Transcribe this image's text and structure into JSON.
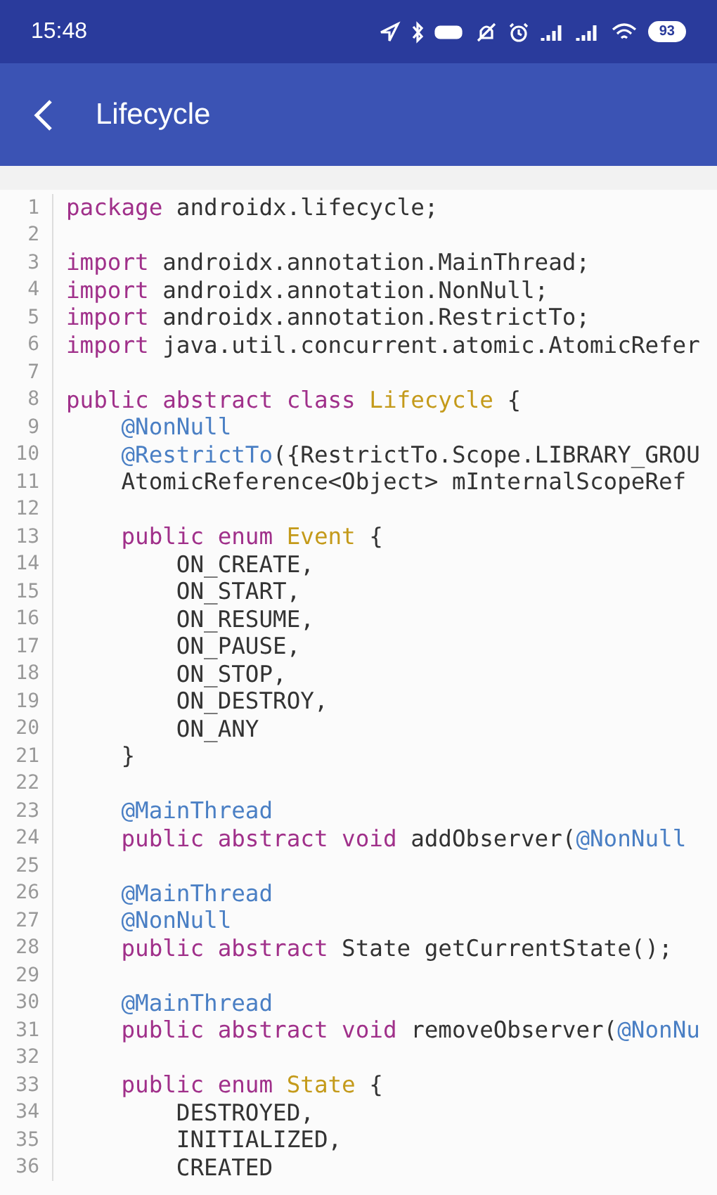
{
  "status_bar": {
    "time": "15:48",
    "battery": "93"
  },
  "app_bar": {
    "title": "Lifecycle"
  },
  "code": {
    "lines": [
      {
        "number": "1",
        "tokens": [
          {
            "kind": "keyword",
            "text": "package"
          },
          {
            "kind": "plain",
            "text": " androidx.lifecycle;"
          }
        ]
      },
      {
        "number": "2"
      },
      {
        "number": "3",
        "tokens": [
          {
            "kind": "keyword",
            "text": "import"
          },
          {
            "kind": "plain",
            "text": " androidx.annotation.MainThread;"
          }
        ]
      },
      {
        "number": "4",
        "tokens": [
          {
            "kind": "keyword",
            "text": "import"
          },
          {
            "kind": "plain",
            "text": " androidx.annotation.NonNull;"
          }
        ]
      },
      {
        "number": "5",
        "tokens": [
          {
            "kind": "keyword",
            "text": "import"
          },
          {
            "kind": "plain",
            "text": " androidx.annotation.RestrictTo;"
          }
        ]
      },
      {
        "number": "6",
        "tokens": [
          {
            "kind": "keyword",
            "text": "import"
          },
          {
            "kind": "plain",
            "text": " java.util.concurrent.atomic.AtomicRefer"
          }
        ]
      },
      {
        "number": "7"
      },
      {
        "number": "8",
        "tokens": [
          {
            "kind": "keyword",
            "text": "public abstract class "
          },
          {
            "kind": "type",
            "text": "Lifecycle"
          },
          {
            "kind": "plain",
            "text": " {"
          }
        ]
      },
      {
        "number": "9",
        "tokens": [
          {
            "kind": "annotation",
            "text": "    @NonNull"
          }
        ]
      },
      {
        "number": "10",
        "tokens": [
          {
            "kind": "annotation",
            "text": "    @RestrictTo"
          },
          {
            "kind": "plain",
            "text": "({RestrictTo.Scope.LIBRARY_GROU"
          }
        ]
      },
      {
        "number": "11",
        "tokens": [
          {
            "kind": "plain",
            "text": "    AtomicReference<Object> mInternalScopeRef"
          }
        ]
      },
      {
        "number": "12"
      },
      {
        "number": "13",
        "tokens": [
          {
            "kind": "keyword",
            "text": "    public enum "
          },
          {
            "kind": "type",
            "text": "Event"
          },
          {
            "kind": "plain",
            "text": " {"
          }
        ]
      },
      {
        "number": "14",
        "tokens": [
          {
            "kind": "plain",
            "text": "        ON_CREATE,"
          }
        ]
      },
      {
        "number": "15",
        "tokens": [
          {
            "kind": "plain",
            "text": "        ON_START,"
          }
        ]
      },
      {
        "number": "16",
        "tokens": [
          {
            "kind": "plain",
            "text": "        ON_RESUME,"
          }
        ]
      },
      {
        "number": "17",
        "tokens": [
          {
            "kind": "plain",
            "text": "        ON_PAUSE,"
          }
        ]
      },
      {
        "number": "18",
        "tokens": [
          {
            "kind": "plain",
            "text": "        ON_STOP,"
          }
        ]
      },
      {
        "number": "19",
        "tokens": [
          {
            "kind": "plain",
            "text": "        ON_DESTROY,"
          }
        ]
      },
      {
        "number": "20",
        "tokens": [
          {
            "kind": "plain",
            "text": "        ON_ANY"
          }
        ]
      },
      {
        "number": "21",
        "tokens": [
          {
            "kind": "plain",
            "text": "    }"
          }
        ]
      },
      {
        "number": "22"
      },
      {
        "number": "23",
        "tokens": [
          {
            "kind": "annotation",
            "text": "    @MainThread"
          }
        ]
      },
      {
        "number": "24",
        "tokens": [
          {
            "kind": "keyword",
            "text": "    public abstract void"
          },
          {
            "kind": "plain",
            "text": " addObserver("
          },
          {
            "kind": "annotation",
            "text": "@NonNull"
          }
        ]
      },
      {
        "number": "25"
      },
      {
        "number": "26",
        "tokens": [
          {
            "kind": "annotation",
            "text": "    @MainThread"
          }
        ]
      },
      {
        "number": "27",
        "tokens": [
          {
            "kind": "annotation",
            "text": "    @NonNull"
          }
        ]
      },
      {
        "number": "28",
        "tokens": [
          {
            "kind": "keyword",
            "text": "    public abstract"
          },
          {
            "kind": "plain",
            "text": " State getCurrentState();"
          }
        ]
      },
      {
        "number": "29"
      },
      {
        "number": "30",
        "tokens": [
          {
            "kind": "annotation",
            "text": "    @MainThread"
          }
        ]
      },
      {
        "number": "31",
        "tokens": [
          {
            "kind": "keyword",
            "text": "    public abstract void"
          },
          {
            "kind": "plain",
            "text": " removeObserver("
          },
          {
            "kind": "annotation",
            "text": "@NonNu"
          }
        ]
      },
      {
        "number": "32"
      },
      {
        "number": "33",
        "tokens": [
          {
            "kind": "keyword",
            "text": "    public enum "
          },
          {
            "kind": "type",
            "text": "State"
          },
          {
            "kind": "plain",
            "text": " {"
          }
        ]
      },
      {
        "number": "34",
        "tokens": [
          {
            "kind": "plain",
            "text": "        DESTROYED,"
          }
        ]
      },
      {
        "number": "35",
        "tokens": [
          {
            "kind": "plain",
            "text": "        INITIALIZED,"
          }
        ]
      },
      {
        "number": "36",
        "tokens": [
          {
            "kind": "plain",
            "text": "        CREATED"
          }
        ]
      }
    ]
  }
}
